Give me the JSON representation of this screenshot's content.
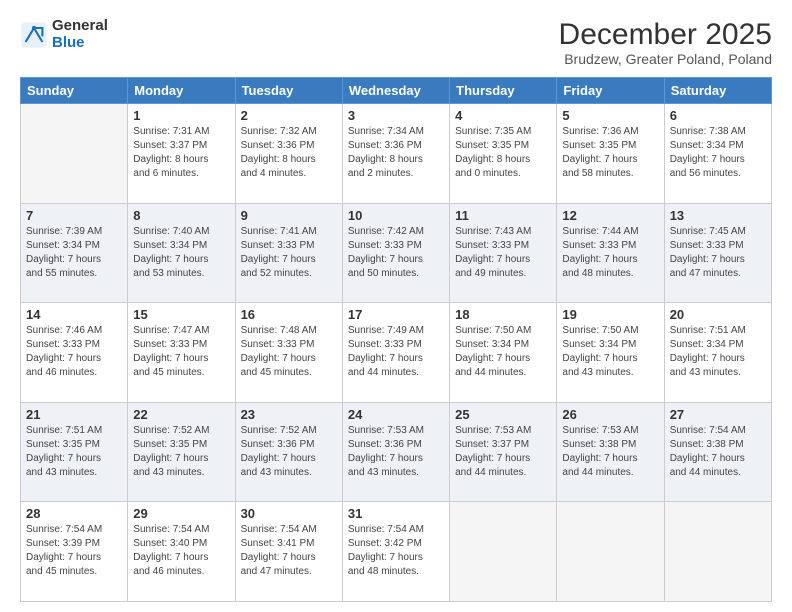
{
  "logo": {
    "text_general": "General",
    "text_blue": "Blue"
  },
  "header": {
    "title": "December 2025",
    "subtitle": "Brudzew, Greater Poland, Poland"
  },
  "weekdays": [
    "Sunday",
    "Monday",
    "Tuesday",
    "Wednesday",
    "Thursday",
    "Friday",
    "Saturday"
  ],
  "weeks": [
    [
      {
        "day": "",
        "info": ""
      },
      {
        "day": "1",
        "info": "Sunrise: 7:31 AM\nSunset: 3:37 PM\nDaylight: 8 hours\nand 6 minutes."
      },
      {
        "day": "2",
        "info": "Sunrise: 7:32 AM\nSunset: 3:36 PM\nDaylight: 8 hours\nand 4 minutes."
      },
      {
        "day": "3",
        "info": "Sunrise: 7:34 AM\nSunset: 3:36 PM\nDaylight: 8 hours\nand 2 minutes."
      },
      {
        "day": "4",
        "info": "Sunrise: 7:35 AM\nSunset: 3:35 PM\nDaylight: 8 hours\nand 0 minutes."
      },
      {
        "day": "5",
        "info": "Sunrise: 7:36 AM\nSunset: 3:35 PM\nDaylight: 7 hours\nand 58 minutes."
      },
      {
        "day": "6",
        "info": "Sunrise: 7:38 AM\nSunset: 3:34 PM\nDaylight: 7 hours\nand 56 minutes."
      }
    ],
    [
      {
        "day": "7",
        "info": "Sunrise: 7:39 AM\nSunset: 3:34 PM\nDaylight: 7 hours\nand 55 minutes."
      },
      {
        "day": "8",
        "info": "Sunrise: 7:40 AM\nSunset: 3:34 PM\nDaylight: 7 hours\nand 53 minutes."
      },
      {
        "day": "9",
        "info": "Sunrise: 7:41 AM\nSunset: 3:33 PM\nDaylight: 7 hours\nand 52 minutes."
      },
      {
        "day": "10",
        "info": "Sunrise: 7:42 AM\nSunset: 3:33 PM\nDaylight: 7 hours\nand 50 minutes."
      },
      {
        "day": "11",
        "info": "Sunrise: 7:43 AM\nSunset: 3:33 PM\nDaylight: 7 hours\nand 49 minutes."
      },
      {
        "day": "12",
        "info": "Sunrise: 7:44 AM\nSunset: 3:33 PM\nDaylight: 7 hours\nand 48 minutes."
      },
      {
        "day": "13",
        "info": "Sunrise: 7:45 AM\nSunset: 3:33 PM\nDaylight: 7 hours\nand 47 minutes."
      }
    ],
    [
      {
        "day": "14",
        "info": "Sunrise: 7:46 AM\nSunset: 3:33 PM\nDaylight: 7 hours\nand 46 minutes."
      },
      {
        "day": "15",
        "info": "Sunrise: 7:47 AM\nSunset: 3:33 PM\nDaylight: 7 hours\nand 45 minutes."
      },
      {
        "day": "16",
        "info": "Sunrise: 7:48 AM\nSunset: 3:33 PM\nDaylight: 7 hours\nand 45 minutes."
      },
      {
        "day": "17",
        "info": "Sunrise: 7:49 AM\nSunset: 3:33 PM\nDaylight: 7 hours\nand 44 minutes."
      },
      {
        "day": "18",
        "info": "Sunrise: 7:50 AM\nSunset: 3:34 PM\nDaylight: 7 hours\nand 44 minutes."
      },
      {
        "day": "19",
        "info": "Sunrise: 7:50 AM\nSunset: 3:34 PM\nDaylight: 7 hours\nand 43 minutes."
      },
      {
        "day": "20",
        "info": "Sunrise: 7:51 AM\nSunset: 3:34 PM\nDaylight: 7 hours\nand 43 minutes."
      }
    ],
    [
      {
        "day": "21",
        "info": "Sunrise: 7:51 AM\nSunset: 3:35 PM\nDaylight: 7 hours\nand 43 minutes."
      },
      {
        "day": "22",
        "info": "Sunrise: 7:52 AM\nSunset: 3:35 PM\nDaylight: 7 hours\nand 43 minutes."
      },
      {
        "day": "23",
        "info": "Sunrise: 7:52 AM\nSunset: 3:36 PM\nDaylight: 7 hours\nand 43 minutes."
      },
      {
        "day": "24",
        "info": "Sunrise: 7:53 AM\nSunset: 3:36 PM\nDaylight: 7 hours\nand 43 minutes."
      },
      {
        "day": "25",
        "info": "Sunrise: 7:53 AM\nSunset: 3:37 PM\nDaylight: 7 hours\nand 44 minutes."
      },
      {
        "day": "26",
        "info": "Sunrise: 7:53 AM\nSunset: 3:38 PM\nDaylight: 7 hours\nand 44 minutes."
      },
      {
        "day": "27",
        "info": "Sunrise: 7:54 AM\nSunset: 3:38 PM\nDaylight: 7 hours\nand 44 minutes."
      }
    ],
    [
      {
        "day": "28",
        "info": "Sunrise: 7:54 AM\nSunset: 3:39 PM\nDaylight: 7 hours\nand 45 minutes."
      },
      {
        "day": "29",
        "info": "Sunrise: 7:54 AM\nSunset: 3:40 PM\nDaylight: 7 hours\nand 46 minutes."
      },
      {
        "day": "30",
        "info": "Sunrise: 7:54 AM\nSunset: 3:41 PM\nDaylight: 7 hours\nand 47 minutes."
      },
      {
        "day": "31",
        "info": "Sunrise: 7:54 AM\nSunset: 3:42 PM\nDaylight: 7 hours\nand 48 minutes."
      },
      {
        "day": "",
        "info": ""
      },
      {
        "day": "",
        "info": ""
      },
      {
        "day": "",
        "info": ""
      }
    ]
  ]
}
